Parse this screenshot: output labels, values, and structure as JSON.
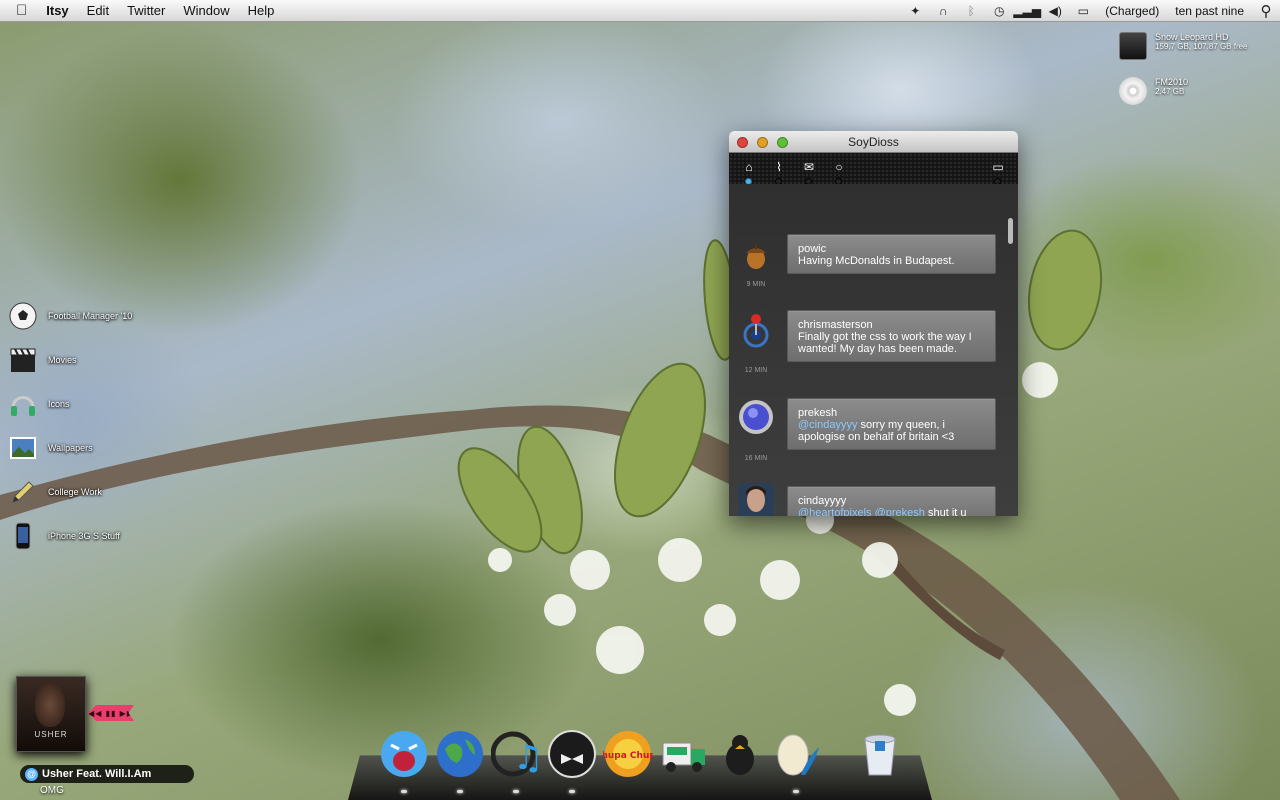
{
  "menubar": {
    "app_name": "Itsy",
    "menus": [
      "Edit",
      "Twitter",
      "Window",
      "Help"
    ],
    "battery_status": "(Charged)",
    "clock": "ten past nine",
    "status_icons": [
      "butterfly-icon",
      "headphones-icon",
      "bluetooth-icon",
      "time-machine-icon",
      "wifi-icon",
      "volume-icon",
      "battery-icon",
      "spotlight-icon"
    ]
  },
  "drives": [
    {
      "name": "Snow Leopard HD",
      "info": "159.7 GB, 107.87 GB free",
      "icon": "hard-drive-icon"
    },
    {
      "name": "FM2010",
      "info": "2.47 GB",
      "icon": "dvd-icon"
    }
  ],
  "desktop_items": [
    {
      "label": "Football Manager '10",
      "icon": "soccer-ball-icon"
    },
    {
      "label": "Movies",
      "icon": "clapperboard-icon"
    },
    {
      "label": "Icons",
      "icon": "headphones-icon"
    },
    {
      "label": "Wallpapers",
      "icon": "picture-icon"
    },
    {
      "label": "College Work",
      "icon": "pencil-icon"
    },
    {
      "label": "iPhone 3G S Stuff",
      "icon": "iphone-icon"
    }
  ],
  "twitter_window": {
    "title": "SoyDioss",
    "toolbar_icons": [
      "home-icon",
      "paperclip-icon",
      "mail-icon",
      "search-icon",
      "compose-icon"
    ],
    "active_tab": "home",
    "tweets": [
      {
        "user": "powic",
        "text": "Having McDonalds in Budapest.",
        "time": "9 MIN",
        "avatar": "acorn"
      },
      {
        "user": "chrismasterson",
        "text": "Finally got the css to work the way I wanted! My day has been made.",
        "time": "12 MIN",
        "avatar": "pin"
      },
      {
        "user": "prekesh",
        "mention": "@cindayyyy",
        "text": " sorry my queen, i apologise on behalf of britain <3",
        "time": "16 MIN",
        "avatar": "orb"
      },
      {
        "user": "cindayyyy",
        "mention": "@heartofpixels",
        "mention2": "@prekesh",
        "text": " shut it u",
        "avatar": "photo"
      }
    ]
  },
  "dock": {
    "apps": [
      "Yell",
      "Earth",
      "iTunes",
      "Tuxedo",
      "Chupa Chups",
      "Delivery Truck",
      "Penguin",
      "Egg Quill",
      "Trash"
    ],
    "chupa_label": "Chupa Chups"
  },
  "now_playing": {
    "artist": "Usher Feat. Will.I.Am",
    "album": "OMG",
    "cover_text": "USHER",
    "controls": "◀◀ ▮▮ ▶▶"
  },
  "colors": {
    "accent": "#4fb2e8",
    "mention": "#8cc8ff",
    "player_tag": "#e7406e"
  }
}
